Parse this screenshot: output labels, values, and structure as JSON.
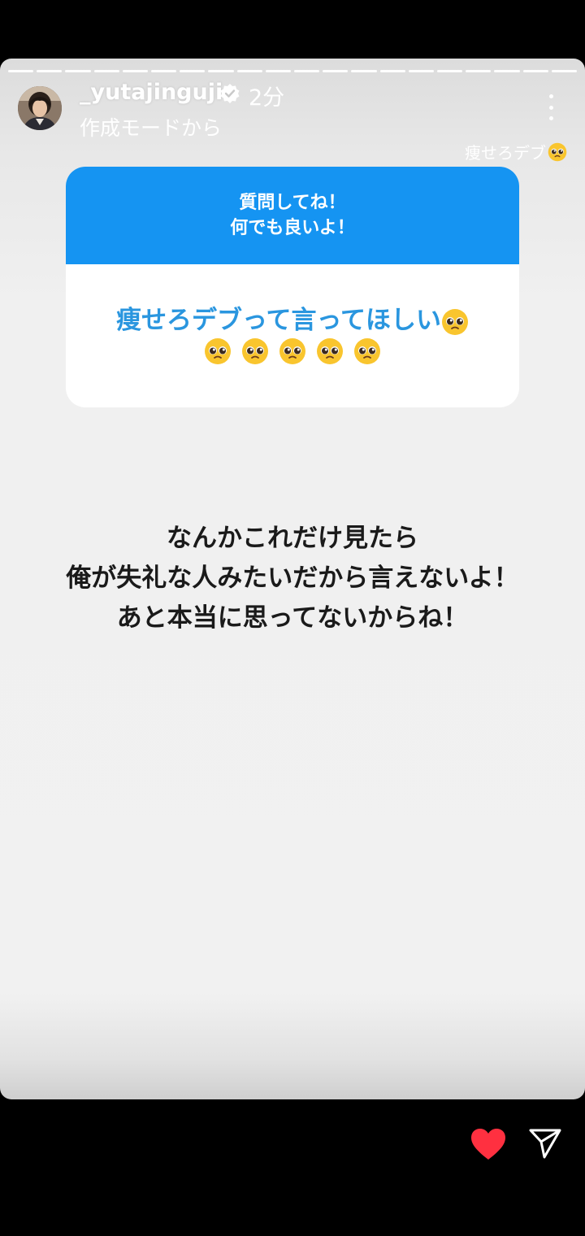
{
  "header": {
    "username": "_yutajinguji",
    "time": "2分",
    "subtitle": "作成モードから",
    "progress_segments": 20
  },
  "caption": {
    "text": "痩せろデブ",
    "emoji": "pleading-face-icon"
  },
  "question_card": {
    "prompt_line1": "質問してね！",
    "prompt_line2": "何でも良いよ！",
    "answer_text": "痩せろデブって言ってほしい",
    "emoji_count_inline": 1,
    "emoji_count_row": 5,
    "header_color": "#1594f2",
    "answer_color": "#2a96df"
  },
  "message": {
    "line1": "なんかこれだけ見たら",
    "line2": "俺が失礼な人みたいだから言えないよ！",
    "line3": "あと本当に思ってないからね！"
  },
  "footer": {
    "like_icon": "heart-icon",
    "like_color": "#ff3040",
    "share_icon": "send-icon"
  }
}
